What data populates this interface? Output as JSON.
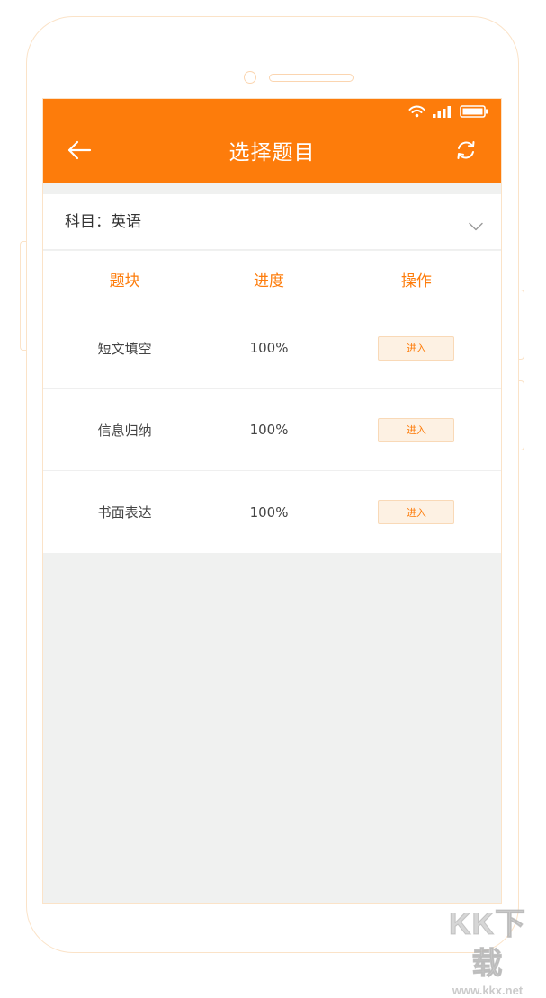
{
  "header": {
    "title": "选择题目",
    "back_icon": "arrow-left-icon",
    "refresh_icon": "refresh-icon"
  },
  "status_bar": {
    "icons": [
      "wifi-icon",
      "signal-icon",
      "battery-icon"
    ]
  },
  "subject": {
    "label": "科目：英语",
    "dropdown_icon": "chevron-down-icon"
  },
  "table": {
    "headers": [
      "题块",
      "进度",
      "操作"
    ],
    "rows": [
      {
        "name": "短文填空",
        "progress": "100%",
        "action": "进入"
      },
      {
        "name": "信息归纳",
        "progress": "100%",
        "action": "进入"
      },
      {
        "name": "书面表达",
        "progress": "100%",
        "action": "进入"
      }
    ]
  },
  "watermark": {
    "main": "KK下载",
    "sub": "www.kkx.net"
  },
  "colors": {
    "accent": "#fd7c0b",
    "button_bg": "#fdf1e3",
    "screen_bg": "#f0f1f0",
    "phone_outline": "#fbe3c8"
  }
}
